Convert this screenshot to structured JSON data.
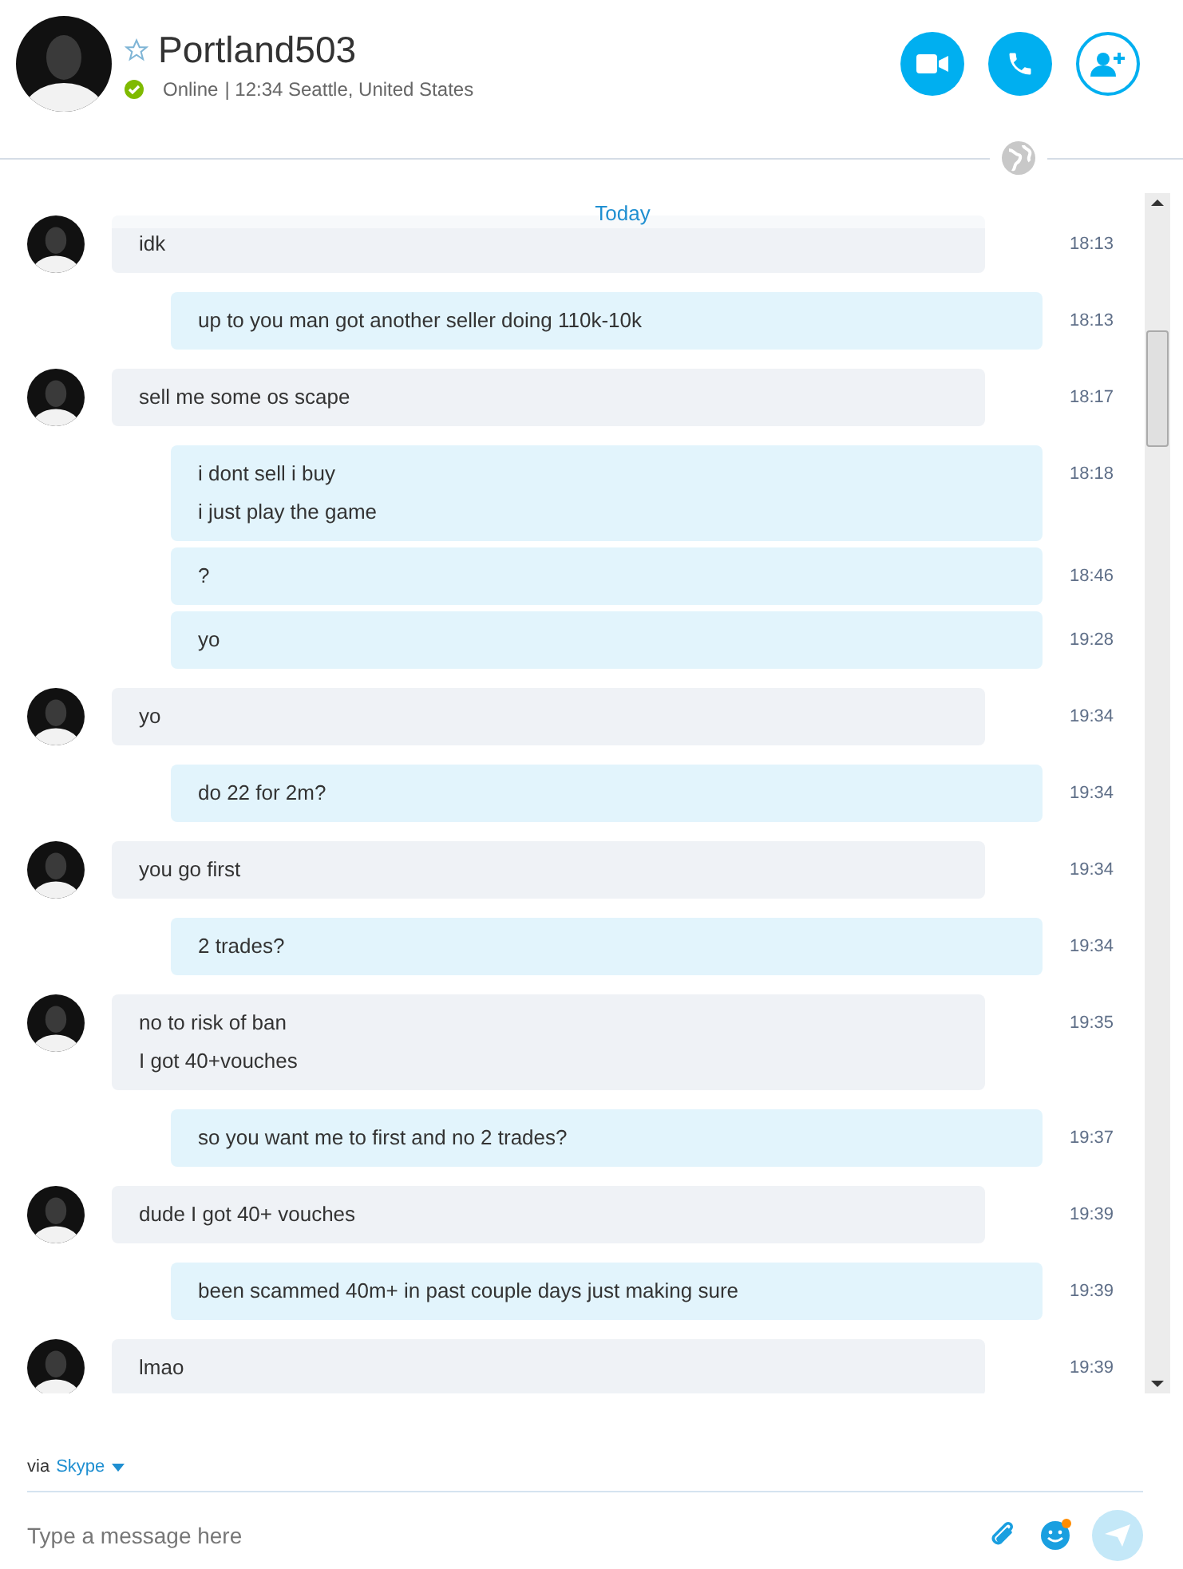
{
  "contact": {
    "name": "Portland503",
    "favorite": false,
    "status": "Online",
    "details": "| 12:34 Seattle, United States"
  },
  "date_divider": "Today",
  "messages": [
    {
      "kind": "in",
      "lines": [
        "idk"
      ],
      "time": "18:13"
    },
    {
      "kind": "out",
      "lines": [
        "up to you man got another seller doing 110k-10k"
      ],
      "time": "18:13"
    },
    {
      "kind": "in",
      "lines": [
        "sell me some os scape"
      ],
      "time": "18:17"
    },
    {
      "kind": "out",
      "lines": [
        "i dont sell i buy",
        "i just play the game"
      ],
      "time": "18:18"
    },
    {
      "kind": "out",
      "lines": [
        "?"
      ],
      "time": "18:46"
    },
    {
      "kind": "out",
      "lines": [
        "yo"
      ],
      "time": "19:28"
    },
    {
      "kind": "in",
      "lines": [
        "yo"
      ],
      "time": "19:34"
    },
    {
      "kind": "out",
      "lines": [
        "do 22 for 2m?"
      ],
      "time": "19:34"
    },
    {
      "kind": "in",
      "lines": [
        "you go first"
      ],
      "time": "19:34"
    },
    {
      "kind": "out",
      "lines": [
        "2 trades?"
      ],
      "time": "19:34"
    },
    {
      "kind": "in",
      "lines": [
        "no to risk of ban",
        "I got 40+vouches"
      ],
      "time": "19:35"
    },
    {
      "kind": "out",
      "lines": [
        "so you want me to first and no 2 trades?"
      ],
      "time": "19:37"
    },
    {
      "kind": "in",
      "lines": [
        "dude I got 40+ vouches"
      ],
      "time": "19:39"
    },
    {
      "kind": "out",
      "lines": [
        "been scammed 40m+ in past couple days just making sure"
      ],
      "time": "19:39"
    },
    {
      "kind": "in",
      "lines": [
        "lmao"
      ],
      "time": "19:39"
    }
  ],
  "footer": {
    "via": "via",
    "service": "Skype",
    "placeholder": "Type a message here"
  }
}
